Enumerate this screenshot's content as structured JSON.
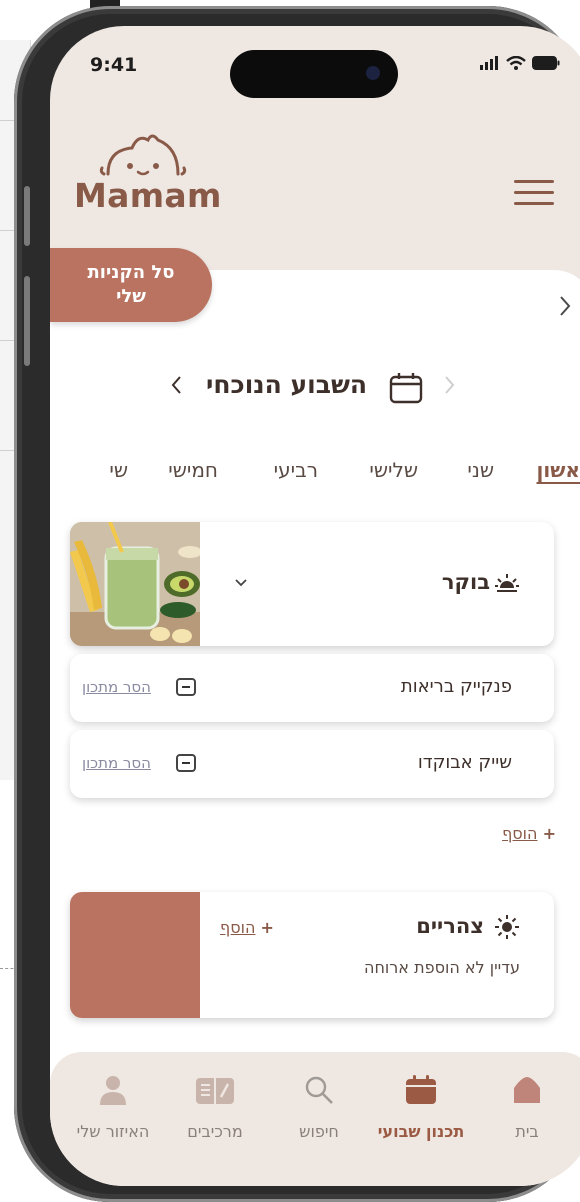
{
  "status": {
    "time": "9:41"
  },
  "brand": {
    "name": "Mamam"
  },
  "cart": {
    "line1": "סל הקניות",
    "line2": "שלי"
  },
  "week": {
    "title": "השבוע הנוכחי"
  },
  "days": [
    "ראשון",
    "שני",
    "שלישי",
    "רביעי",
    "חמישי",
    "שי"
  ],
  "meals": {
    "morning": {
      "title": "בוקר",
      "recipes": [
        {
          "name": "פנקייק בריאות",
          "remove": "הסר מתכון"
        },
        {
          "name": "שייק אבוקדו",
          "remove": "הסר מתכון"
        }
      ],
      "add": "הוסף",
      "add_plus": "+"
    },
    "lunch": {
      "title": "צהריים",
      "add": "הוסף",
      "add_plus": "+",
      "empty": "עדיין לא הוספת ארוחה"
    }
  },
  "nav": [
    {
      "label": "בית",
      "icon": "home-icon"
    },
    {
      "label": "תכנון שבועי",
      "icon": "calendar-icon"
    },
    {
      "label": "חיפוש",
      "icon": "search-icon"
    },
    {
      "label": "מרכיבים",
      "icon": "book-icon"
    },
    {
      "label": "האיזור שלי",
      "icon": "user-icon"
    }
  ],
  "colors": {
    "brand": "#8a5a48",
    "accent": "#b97360",
    "background": "#efe7e2"
  }
}
